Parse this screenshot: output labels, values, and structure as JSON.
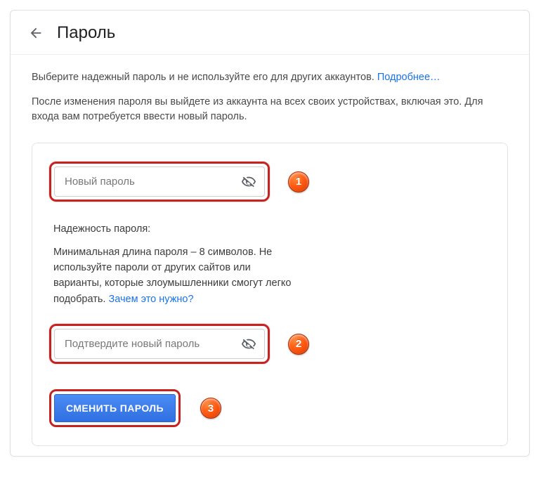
{
  "header": {
    "title": "Пароль"
  },
  "intro": {
    "line1_pre": "Выберите надежный пароль и не используйте его для других аккаунтов. ",
    "learn_more": "Подробнее…",
    "line2": "После изменения пароля вы выйдете из аккаунта на всех своих устройствах, включая это. Для входа вам потребуется ввести новый пароль."
  },
  "fields": {
    "new_password_placeholder": "Новый пароль",
    "confirm_password_placeholder": "Подтвердите новый пароль"
  },
  "strength": {
    "label": "Надежность пароля:",
    "desc_pre": "Минимальная длина пароля – 8 символов. Не используйте пароли от других сайтов или варианты, которые злоумышленники смогут легко подобрать. ",
    "why_link": "Зачем это нужно?"
  },
  "submit": {
    "label": "Сменить пароль"
  },
  "badges": {
    "b1": "1",
    "b2": "2",
    "b3": "3"
  }
}
